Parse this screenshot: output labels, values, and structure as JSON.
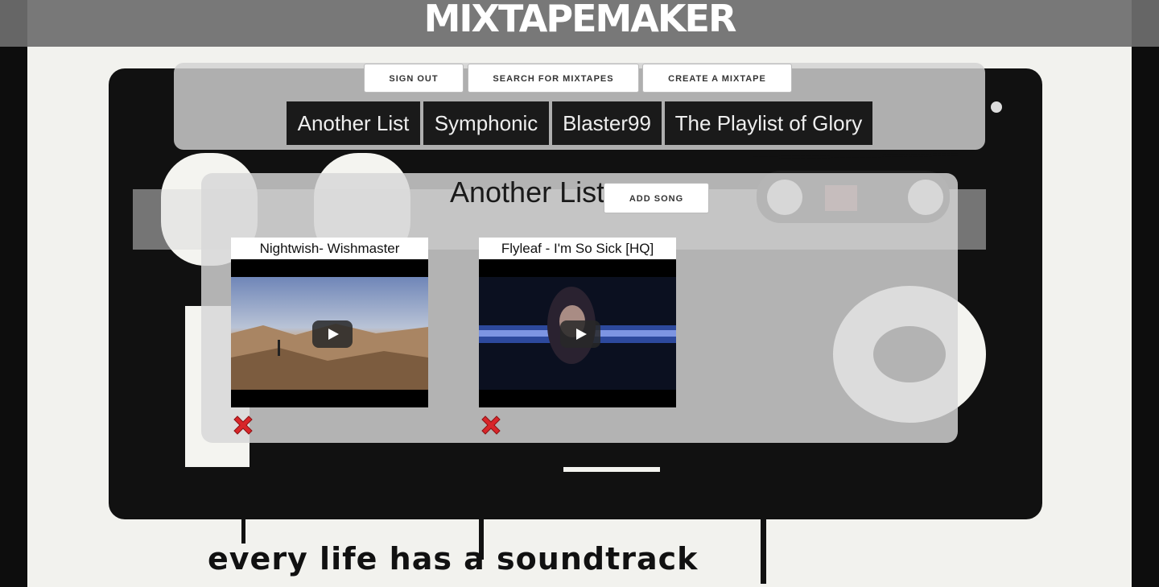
{
  "header": {
    "brand": "MIXTAPEMAKER"
  },
  "nav": {
    "sign_out": "SIGN OUT",
    "search": "SEARCH FOR MIXTAPES",
    "create": "CREATE A MIXTAPE"
  },
  "lists": [
    {
      "label": "Another List"
    },
    {
      "label": "Symphonic"
    },
    {
      "label": "Blaster99"
    },
    {
      "label": "The Playlist of Glory"
    }
  ],
  "current_list": {
    "title": "Another List",
    "add_song_label": "ADD SONG",
    "songs": [
      {
        "title": "Nightwish- Wishmaster",
        "thumb": "desert-landscape"
      },
      {
        "title": "Flyleaf - I'm So Sick [HQ]",
        "thumb": "singer-blue-light"
      }
    ]
  },
  "background": {
    "tagline": "every life has a soundtrack"
  },
  "icons": {
    "play": "play-icon",
    "delete": "red-x-icon"
  },
  "colors": {
    "topbar": "#6e6e6e",
    "tab_bg": "#1a1a1a",
    "delete_red": "#d8262a"
  }
}
